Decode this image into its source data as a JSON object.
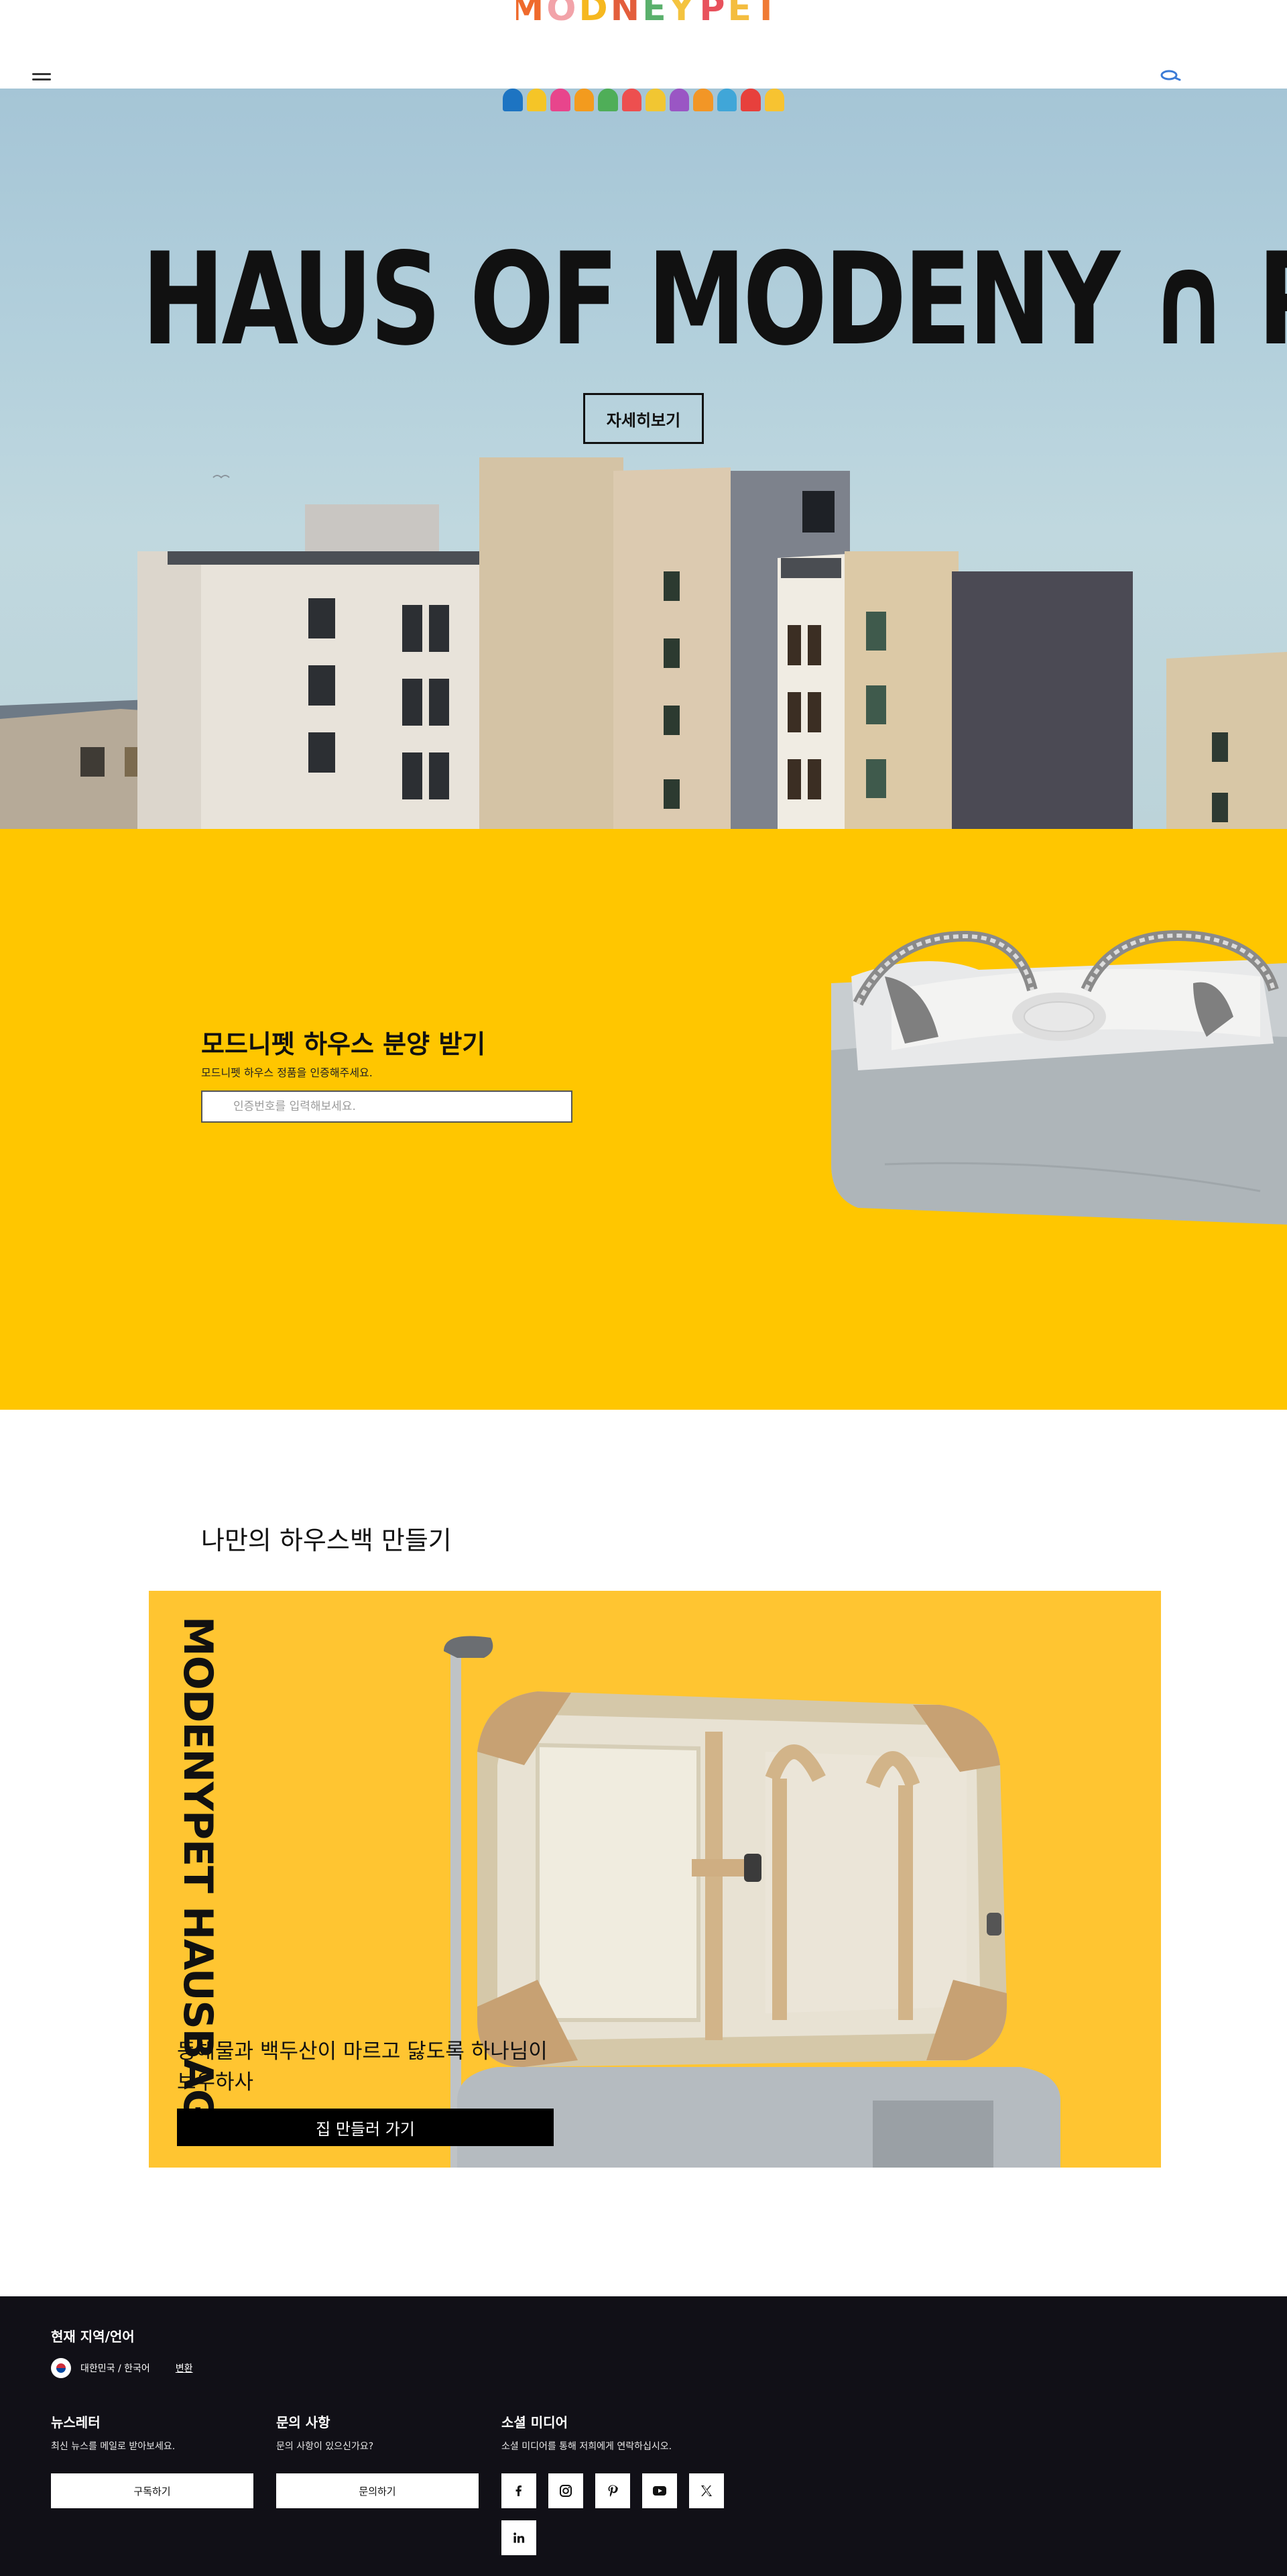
{
  "header": {
    "logo_letters": [
      "M",
      "O",
      "D",
      "N",
      "E",
      "Y",
      " ",
      "P",
      "E",
      "T"
    ],
    "logo_colors": [
      "#ef6a2c",
      "#f2a3a9",
      "#f6b81f",
      "#e35e3c",
      "#5ab06c",
      "#f4c33f",
      "#ffffff",
      "#e8515c",
      "#f4bd3f",
      "#f07a33"
    ]
  },
  "hero": {
    "title": "HAUS OF MODENY ∩ PET",
    "cta_label": "자세히보기",
    "logo_colors": [
      "#1d74c2",
      "#f5c527",
      "#e8458c",
      "#f39b1e",
      "#4fae58",
      "#ed4f4f",
      "#f1c632",
      "#9a56c4",
      "#f29626",
      "#40a6d8",
      "#e7403c",
      "#f7c331"
    ]
  },
  "auth": {
    "title": "모드니펫 하우스 분양 받기",
    "subtitle": "모드니펫 하우스 정품을 인증해주세요.",
    "input_placeholder": "인증번호를 입력해보세요."
  },
  "custom": {
    "title": "나만의 하우스백 만들기",
    "brand_vertical": "MODENYPET HAUSBAG",
    "description_line1": "동해물과 백두산이 마르고 닳도록 하나님이",
    "description_line2": "보우하사",
    "cta_label": "집 만들러 가기"
  },
  "footer": {
    "region_title": "현재 지역/언어",
    "region_value": "대한민국 / 한국어",
    "region_change": "변환",
    "newsletter": {
      "title": "뉴스레터",
      "text": "최신 뉴스를 메일로 받아보세요.",
      "button": "구독하기"
    },
    "inquiry": {
      "title": "문의 사항",
      "text": "문의 사항이 있으신가요?",
      "button": "문의하기"
    },
    "social": {
      "title": "소셜 미디어",
      "text": "소셜 미디어를 통해 저희에게 연락하십시오.",
      "icons": [
        "facebook-icon",
        "instagram-icon",
        "pinterest-icon",
        "youtube-icon",
        "x-icon",
        "linkedin-icon"
      ]
    }
  },
  "colors": {
    "hero_sky": "#a5c5d6",
    "auth_bg": "#ffc600",
    "custom_card_bg": "#ffc531",
    "footer_bg": "#111017",
    "cta_black": "#000000"
  }
}
